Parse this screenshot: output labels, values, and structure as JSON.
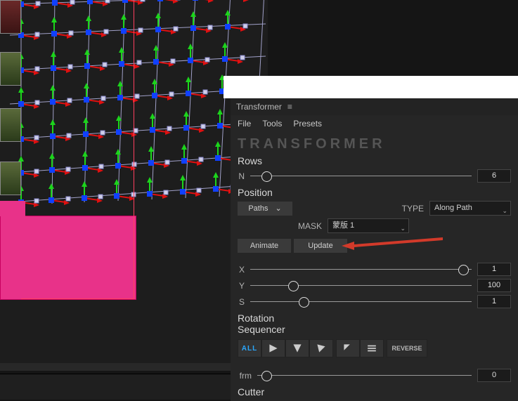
{
  "panel": {
    "title": "Transformer",
    "brand": "TRANSFORMER",
    "menu": {
      "file": "File",
      "tools": "Tools",
      "presets": "Presets"
    },
    "rows": {
      "heading": "Rows",
      "n_label": "N",
      "n_value": "6"
    },
    "position": {
      "heading": "Position",
      "paths_label": "Paths",
      "type_label": "TYPE",
      "type_value": "Along Path",
      "mask_label": "MASK",
      "mask_value": "蒙版 1",
      "animate_label": "Animate",
      "update_label": "Update",
      "x_label": "X",
      "x_value": "1",
      "y_label": "Y",
      "y_value": "100",
      "s_label": "S",
      "s_value": "1"
    },
    "rotation": {
      "heading_line1": "Rotation",
      "heading_line2": "Sequencer",
      "all_label": "ALL",
      "reverse_label": "REVERSE",
      "frm_label": "frm",
      "frm_value": "0"
    },
    "cutter": {
      "heading": "Cutter"
    }
  },
  "sliders": {
    "rows_n_pct": 5,
    "x_pct": 98,
    "y_pct": 17,
    "s_pct": 22,
    "frm_pct": 2
  },
  "icons": {
    "menu": "≡",
    "chevron": "⌄"
  }
}
